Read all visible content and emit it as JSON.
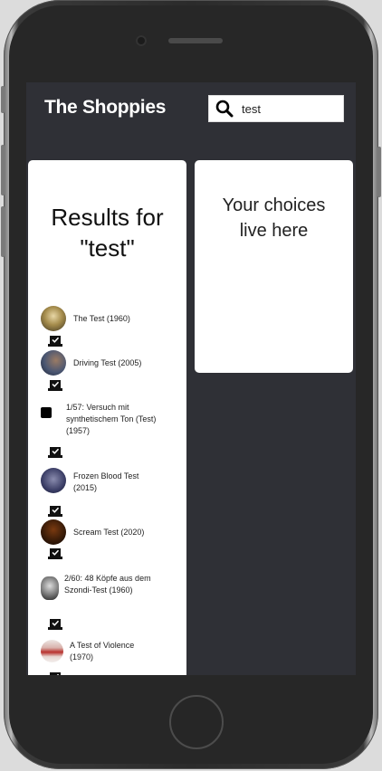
{
  "header": {
    "app_title": "The Shoppies",
    "search_value": "test"
  },
  "results": {
    "heading_line1": "Results for",
    "heading_line2": "\"test\"",
    "items": [
      {
        "label": "The Test (1960)"
      },
      {
        "label": "Driving Test (2005)"
      },
      {
        "label": "1/57: Versuch mit synthetischem Ton (Test) (1957)"
      },
      {
        "label": "Frozen  Blood Test (2015)"
      },
      {
        "label": "Scream Test (2020)"
      },
      {
        "label": "2/60: 48  Köpfe aus dem Szondi-Test (1960)"
      },
      {
        "label": "A Test of Violence (1970)"
      }
    ]
  },
  "choices": {
    "line1": "Your choices",
    "line2": "live here"
  },
  "colors": {
    "screen_bg": "#2f3036",
    "card_bg": "#ffffff"
  }
}
